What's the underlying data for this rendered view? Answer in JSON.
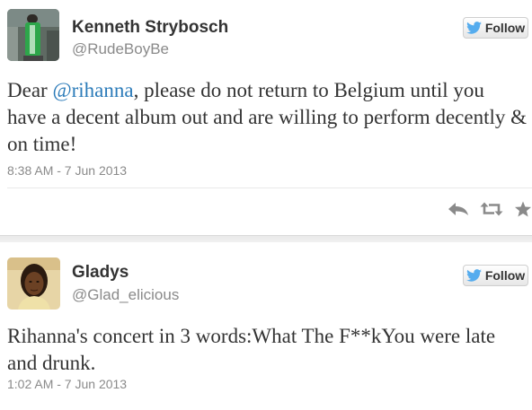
{
  "tweets": [
    {
      "display_name": "Kenneth Strybosch",
      "username": "@RudeBoyBe",
      "follow_label": "Follow",
      "text_before": "Dear ",
      "mention": "@rihanna",
      "text_after": ", please do not return to Belgium until you have a decent album out and are willing to perform decently & on time!",
      "timestamp": "8:38 AM - 7 Jun 2013",
      "actions": [
        "reply-icon",
        "retweet-icon",
        "favorite-icon"
      ]
    },
    {
      "display_name": "Gladys",
      "username": "@Glad_elicious",
      "follow_label": "Follow",
      "text": "Rihanna's concert in 3 words:What The F**kYou were late and drunk.",
      "timestamp": "1:02 AM - 7 Jun 2013"
    }
  ],
  "colors": {
    "link": "#2b7bb9",
    "twitter_bird": "#55acee",
    "secondary_text": "#8a8a8a",
    "primary_text": "#333333"
  }
}
